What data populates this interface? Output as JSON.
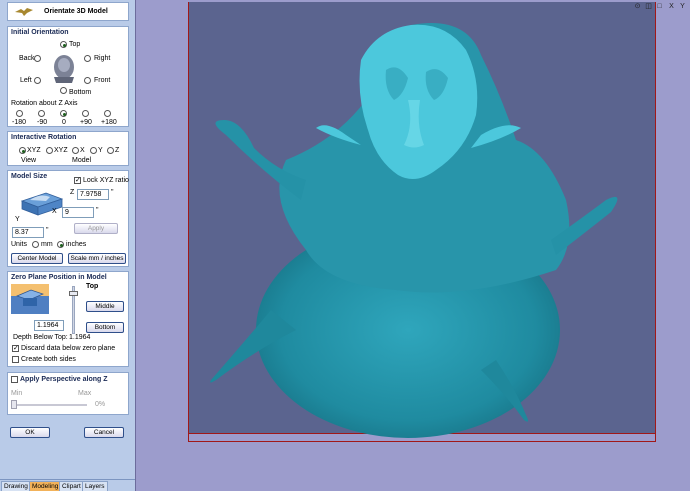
{
  "panel": {
    "title": "Orientate 3D Model",
    "initial_orientation": {
      "header": "Initial Orientation",
      "top": "Top",
      "back": "Back",
      "right": "Right",
      "left": "Left",
      "front": "Front",
      "bottom": "Bottom",
      "rotation_label": "Rotation about Z Axis",
      "rotation_options": [
        "-180",
        "-90",
        "0",
        "+90",
        "+180"
      ],
      "rotation_selected": "0"
    },
    "interactive_rotation": {
      "header": "Interactive Rotation",
      "options": [
        "XYZ",
        "XYZ",
        "X",
        "Y",
        "Z"
      ],
      "view_label": "View",
      "model_label": "Model"
    },
    "model_size": {
      "header": "Model Size",
      "lock_label": "Lock XYZ ratio",
      "z_value": "7.9758",
      "x_value": "9",
      "y_value": "8.37",
      "x_axis": "X",
      "y_axis": "Y",
      "z_axis": "Z",
      "apply_label": "Apply",
      "units_label": "Units",
      "mm_label": "mm",
      "inches_label": "inches",
      "center_label": "Center Model",
      "scale_label": "Scale mm / inches"
    },
    "zero_plane": {
      "header": "Zero Plane Position in Model",
      "top_label": "Top",
      "middle_label": "Middle",
      "bottom_label": "Bottom",
      "value": "1.1964",
      "depth_label": "Depth Below Top:",
      "depth_value": "1.1964",
      "discard_label": "Discard data below zero plane",
      "both_sides_label": "Create both sides"
    },
    "perspective": {
      "header": "Apply Perspective along Z",
      "min_label": "Min",
      "max_label": "Max",
      "percent": "0%",
      "level": 0
    },
    "ok_label": "OK",
    "cancel_label": "Cancel"
  },
  "tabs": [
    "Drawing",
    "Modeling",
    "Clipart",
    "Layers"
  ],
  "active_tab": "Modeling",
  "view_axes": [
    "X",
    "Y"
  ],
  "colors": {
    "panel_bg": "#b9cbe8",
    "viewport_bg": "#9c9ccc",
    "plane": "#56608a",
    "model": "#2a9fb4",
    "model_light": "#4cc8dc",
    "boundary": "#a01818",
    "active_tab": "#f2b25a"
  }
}
